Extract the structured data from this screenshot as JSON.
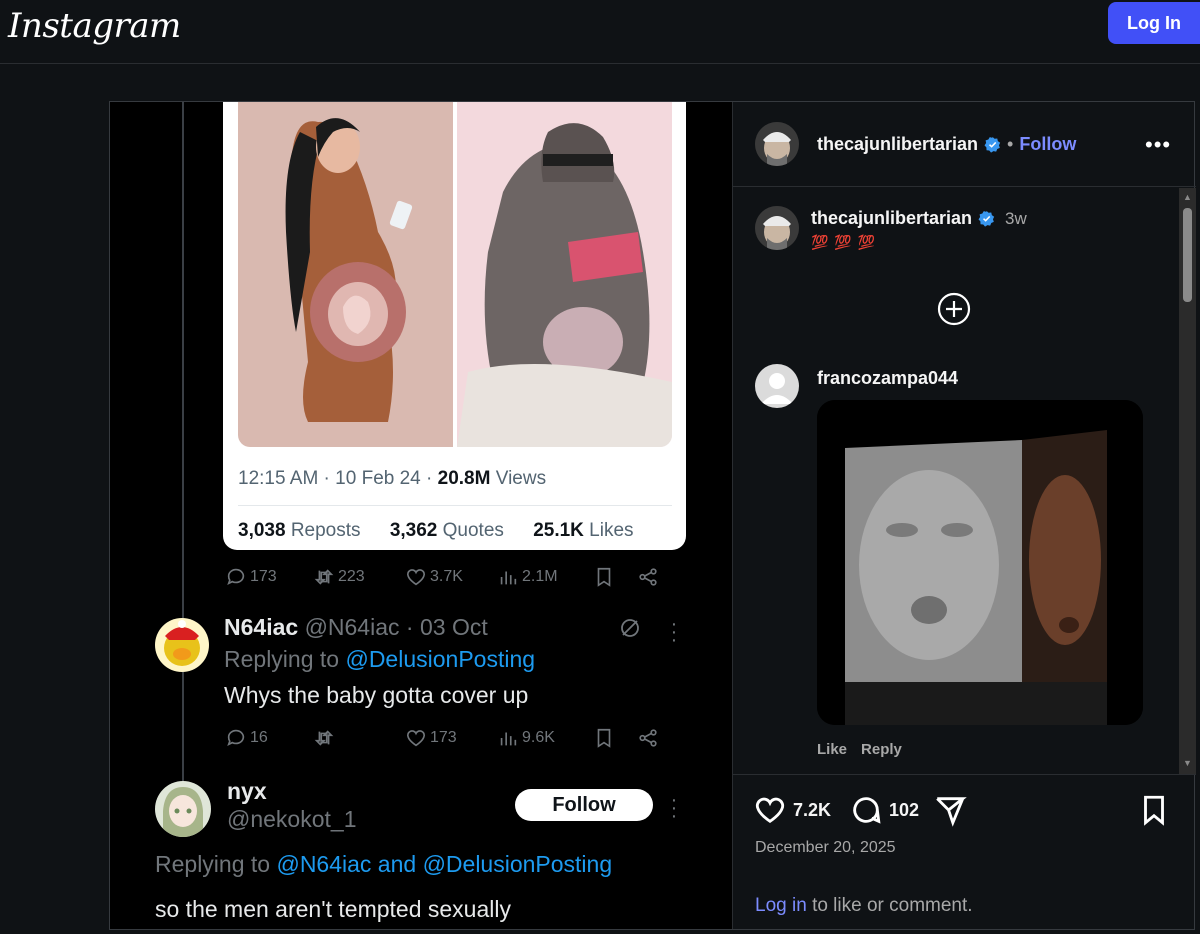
{
  "header": {
    "logo": "Instagram",
    "login_button": "Log In"
  },
  "tweet": {
    "time": "12:15 AM",
    "date": "10 Feb 24",
    "views_count": "20.8M",
    "views_label": "Views",
    "reposts_count": "3,038",
    "reposts_label": "Reposts",
    "quotes_count": "3,362",
    "quotes_label": "Quotes",
    "likes_count": "25.1K",
    "likes_label": "Likes",
    "actions": {
      "replies": "173",
      "reposts": "223",
      "likes": "3.7K",
      "views": "2.1M"
    }
  },
  "reply1": {
    "name": "N64iac",
    "handle": "@N64iac",
    "date": "03 Oct",
    "replying_prefix": "Replying to",
    "replying_to": "@DelusionPosting",
    "text": "Whys the baby gotta cover up",
    "actions": {
      "replies": "16",
      "reposts": "",
      "likes": "173",
      "views": "9.6K"
    }
  },
  "reply2": {
    "name": "nyx",
    "handle": "@nekokot_1",
    "follow": "Follow",
    "replying_prefix": "Replying to",
    "replying_to": "@N64iac and @DelusionPosting",
    "text": "so the men aren't tempted sexually"
  },
  "side": {
    "author": "thecajunlibertarian",
    "follow": "Follow",
    "separator": "•",
    "more": "•••",
    "caption_user": "thecajunlibertarian",
    "caption_time": "3w",
    "caption_text": "💯 💯 💯",
    "commenter": "francozampa044",
    "comment_like": "Like",
    "comment_reply": "Reply",
    "likes": "7.2K",
    "comments": "102",
    "post_date": "December 20, 2025",
    "login_link": "Log in",
    "login_suffix": "to like or comment."
  },
  "colors": {
    "accent": "#4150f7",
    "link": "#7c8cff",
    "twitter_blue": "#1d9bf0"
  }
}
